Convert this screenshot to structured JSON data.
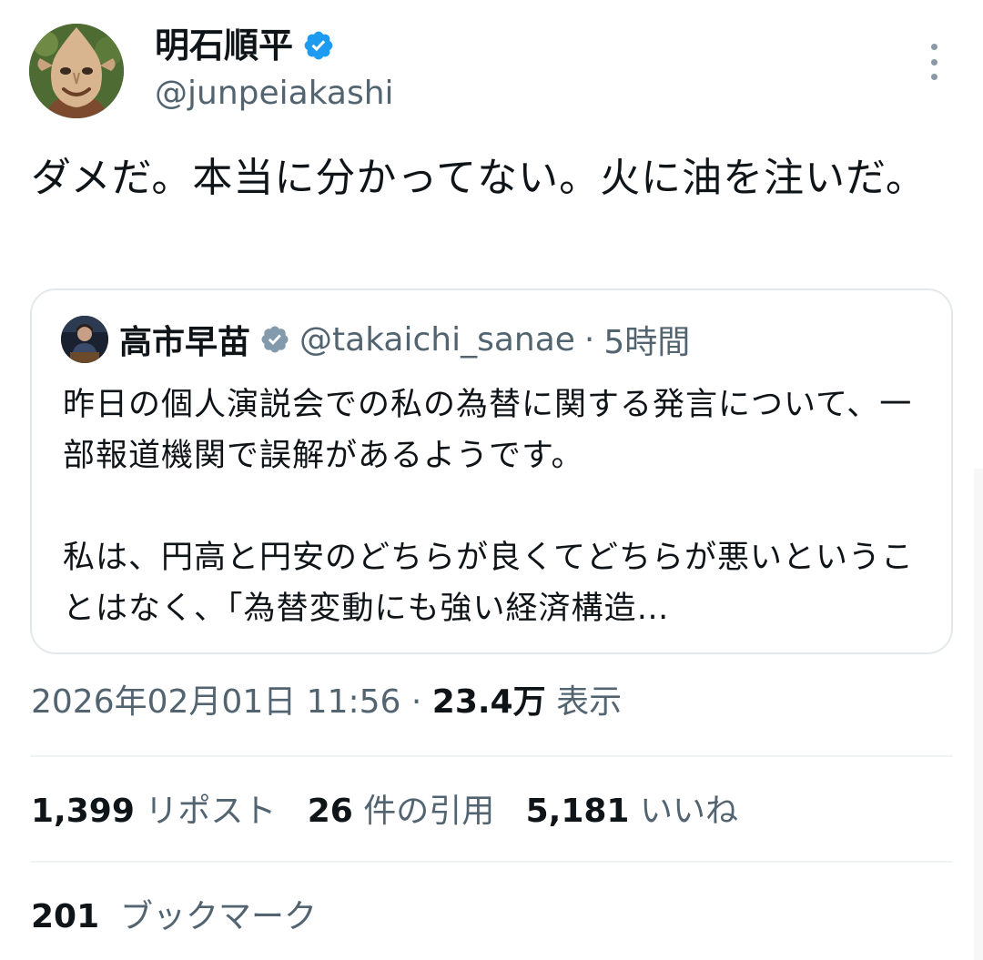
{
  "author": {
    "display_name": "明石順平",
    "handle": "@junpeiakashi",
    "verified": true,
    "avatar_icon": "mask-avatar"
  },
  "tweet": {
    "text": "ダメだ。本当に分かってない。火に油を注いだ。"
  },
  "quoted_tweet": {
    "display_name": "高市早苗",
    "handle": "@takaichi_sanae",
    "separator": " · ",
    "time": "5時間",
    "paragraph1": "昨日の個人演説会での私の為替に関する発言について、一部報道機関で誤解があるようです。",
    "paragraph2": "私は、円高と円安のどちらが良くてどちらが悪いということはなく、「為替変動にも強い経済構造…"
  },
  "meta": {
    "timestamp": "2026年02月01日 11:56",
    "separator": " · ",
    "views_count": "23.4万",
    "views_label": "表示"
  },
  "stats": {
    "reposts_count": "1,399",
    "reposts_label": "リポスト",
    "quotes_count": "26",
    "quotes_label": "件の引用",
    "likes_count": "5,181",
    "likes_label": "いいね",
    "bookmarks_count": "201",
    "bookmarks_label": "ブックマーク"
  },
  "colors": {
    "verified_blue": "#1d9bf0",
    "verified_gray": "#829aab",
    "secondary_text": "#536471",
    "primary_text": "#0f1419"
  }
}
